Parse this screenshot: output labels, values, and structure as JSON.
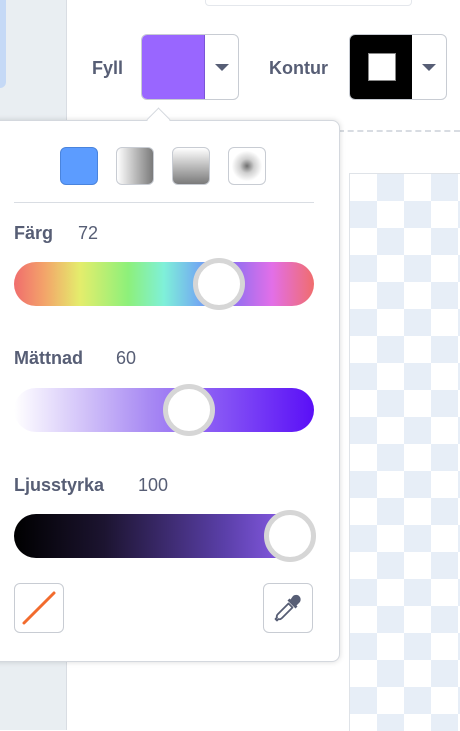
{
  "toolbar": {
    "fill_label": "Fyll",
    "outline_label": "Kontur",
    "fill_color": "#9966ff",
    "outline_color": "#000000"
  },
  "gradient_types": [
    {
      "name": "solid",
      "selected": true
    },
    {
      "name": "horizontal-gradient",
      "selected": false
    },
    {
      "name": "vertical-gradient",
      "selected": false
    },
    {
      "name": "radial-gradient",
      "selected": false
    }
  ],
  "sliders": {
    "color": {
      "label": "Färg",
      "value": "72"
    },
    "saturation": {
      "label": "Mättnad",
      "value": "60"
    },
    "brightness": {
      "label": "Ljusstyrka",
      "value": "100"
    }
  },
  "tools": {
    "no_color_icon": "no-color-slash-icon",
    "eyedropper_icon": "eyedropper-icon"
  }
}
